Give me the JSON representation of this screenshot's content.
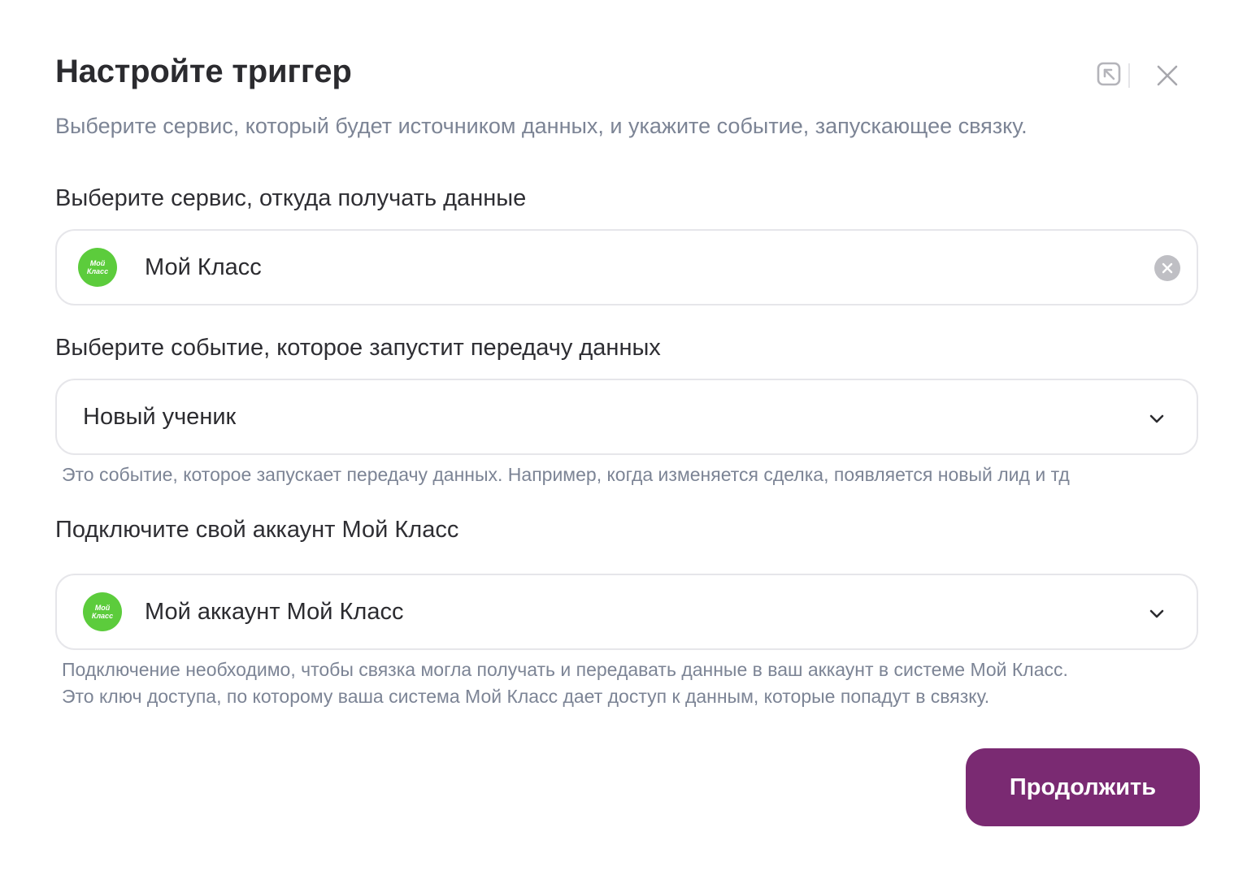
{
  "dialog": {
    "title": "Настройте триггер",
    "subtitle": "Выберите сервис, который будет источником данных, и укажите событие, запускающее связку.",
    "header_icons": [
      "collapse-icon",
      "close-icon"
    ]
  },
  "service": {
    "label": "Выберите сервис, откуда получать данные",
    "value": "Мой Класс",
    "logo_line1": "Мой",
    "logo_line2": "Класс",
    "logo_color": "#5ccc3c"
  },
  "event": {
    "label": "Выберите событие, которое запустит передачу данных",
    "value": "Новый ученик",
    "hint": "Это событие, которое запускает передачу данных. Например, когда изменяется сделка, появляется новый лид и тд"
  },
  "account": {
    "label": "Подключите свой аккаунт Мой Класс",
    "value": "Мой аккаунт Мой Класс",
    "logo_line1": "Мой",
    "logo_line2": "Класс",
    "hint_line1": "Подключение необходимо, чтобы связка могла получать и передавать данные в ваш аккаунт в системе Мой Класс.",
    "hint_line2": "Это ключ доступа, по которому ваша система Мой Класс дает доступ к данным, которые попадут в связку."
  },
  "actions": {
    "continue_label": "Продолжить",
    "continue_color": "#7a2a72"
  }
}
